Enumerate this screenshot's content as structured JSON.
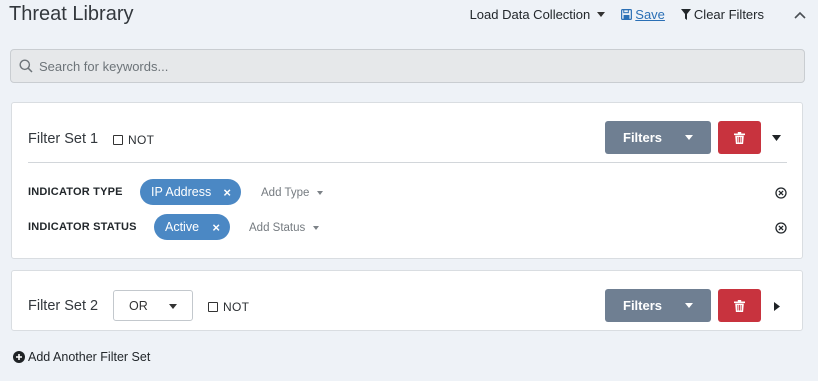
{
  "header": {
    "title": "Threat Library",
    "load_label": "Load Data Collection",
    "save_label": "Save",
    "clear_label": "Clear Filters"
  },
  "search": {
    "placeholder": "Search for keywords..."
  },
  "filter_sets": [
    {
      "label": "Filter Set 1",
      "not_label": "NOT",
      "filters_label": "Filters",
      "expanded": true,
      "rows": [
        {
          "label": "INDICATOR TYPE",
          "chip": "IP Address",
          "add_label": "Add Type"
        },
        {
          "label": "INDICATOR STATUS",
          "chip": "Active",
          "add_label": "Add Status"
        }
      ]
    },
    {
      "label": "Filter Set 2",
      "operator": "OR",
      "not_label": "NOT",
      "filters_label": "Filters",
      "expanded": false
    }
  ],
  "add_filter_set_label": "Add Another Filter Set",
  "colors": {
    "background": "#eef2f7",
    "filters_button": "#6f7f92",
    "delete_button": "#c8333e",
    "chip": "#4b88c4",
    "link": "#2a6fb5"
  },
  "icons": {
    "save": "floppy-disk-icon",
    "clear": "funnel-icon",
    "collapse": "chevron-up-icon",
    "search": "magnifier-icon",
    "delete": "trash-icon",
    "row_clear": "circle-x-icon",
    "add": "plus-circle-icon"
  }
}
